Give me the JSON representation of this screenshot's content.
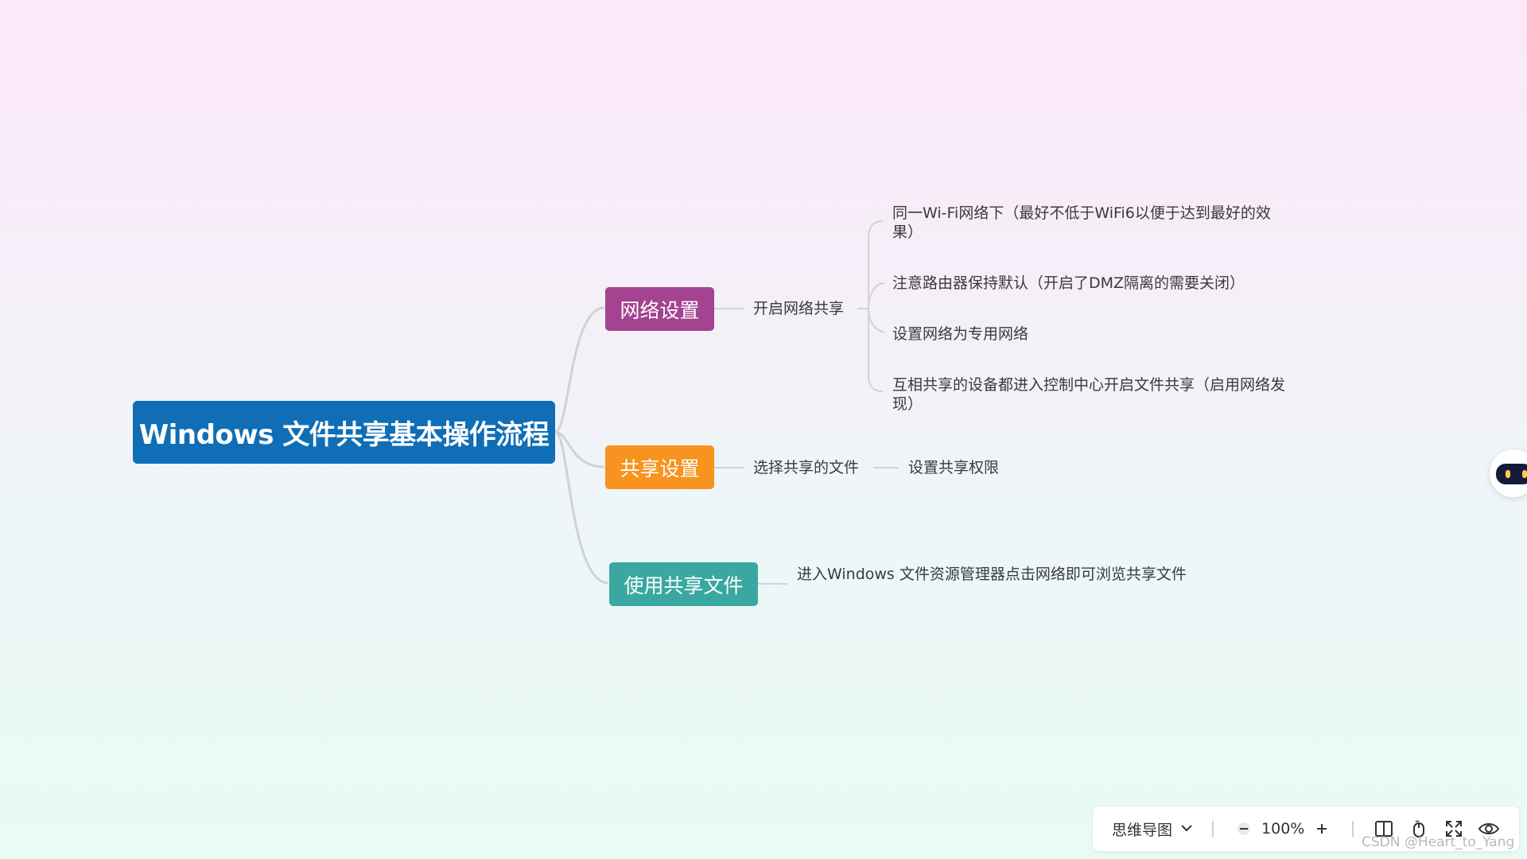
{
  "mindmap": {
    "root": {
      "label": "Windows 文件共享基本操作流程",
      "color": "#0f6eb5"
    },
    "branches": [
      {
        "label": "网络设置",
        "color": "#a4438f",
        "child": "开启网络共享",
        "leaves": [
          "同一Wi-Fi网络下（最好不低于WiFi6以便于达到最好的效果）",
          "注意路由器保持默认（开启了DMZ隔离的需要关闭）",
          "设置网络为专用网络",
          "互相共享的设备都进入控制中心开启文件共享（启用网络发现）"
        ]
      },
      {
        "label": "共享设置",
        "color": "#f7931e",
        "child": "选择共享的文件",
        "leaf": "设置共享权限"
      },
      {
        "label": "使用共享文件",
        "color": "#3aa8a0",
        "child": "进入Windows 文件资源管理器点击网络即可浏览共享文件"
      }
    ],
    "link_color": "#d2d2d2"
  },
  "toolbar": {
    "mode_label": "思维导图",
    "zoom": "100%",
    "icons": [
      "minus-icon",
      "plus-icon",
      "split-view-icon",
      "mouse-icon",
      "fullscreen-icon",
      "eye-icon"
    ]
  },
  "watermark": "CSDN @Heart_to_Yang"
}
